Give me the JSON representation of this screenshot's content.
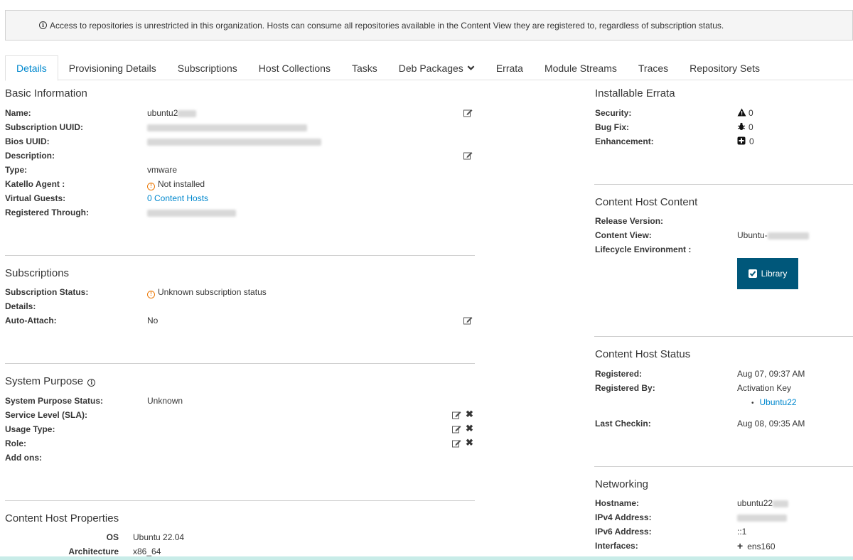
{
  "alert": {
    "text": "Access to repositories is unrestricted in this organization. Hosts can consume all repositories available in the Content View they are registered to, regardless of subscription status."
  },
  "tabs": [
    {
      "label": "Details"
    },
    {
      "label": "Provisioning Details"
    },
    {
      "label": "Subscriptions"
    },
    {
      "label": "Host Collections"
    },
    {
      "label": "Tasks"
    },
    {
      "label": "Deb Packages"
    },
    {
      "label": "Errata"
    },
    {
      "label": "Module Streams"
    },
    {
      "label": "Traces"
    },
    {
      "label": "Repository Sets"
    }
  ],
  "basic": {
    "title": "Basic Information",
    "name_label": "Name:",
    "name_value": "ubuntu2",
    "uuid_label": "Subscription UUID:",
    "bios_label": "Bios UUID:",
    "desc_label": "Description:",
    "type_label": "Type:",
    "type_value": "vmware",
    "agent_label": "Katello Agent :",
    "agent_value": "Not installed",
    "guests_label": "Virtual Guests:",
    "guests_value": "0 Content Hosts",
    "through_label": "Registered Through:"
  },
  "subs": {
    "title": "Subscriptions",
    "status_label": "Subscription Status:",
    "status_value": "Unknown subscription status",
    "details_label": "Details:",
    "auto_label": "Auto-Attach:",
    "auto_value": "No"
  },
  "purpose": {
    "title": "System Purpose",
    "status_label": "System Purpose Status:",
    "status_value": "Unknown",
    "sla_label": "Service Level (SLA):",
    "usage_label": "Usage Type:",
    "role_label": "Role:",
    "addons_label": "Add ons:"
  },
  "props": {
    "title": "Content Host Properties",
    "os_label": "OS",
    "os_value": "Ubuntu 22.04",
    "arch_label": "Architecture",
    "arch_value": "x86_64"
  },
  "errata": {
    "title": "Installable Errata",
    "security_label": "Security:",
    "security_value": "0",
    "bugfix_label": "Bug Fix:",
    "bugfix_value": "0",
    "enh_label": "Enhancement:",
    "enh_value": "0"
  },
  "content": {
    "title": "Content Host Content",
    "release_label": "Release Version:",
    "cv_label": "Content View:",
    "cv_value": "Ubuntu-",
    "lce_label": "Lifecycle Environment :",
    "lce_button": "Library"
  },
  "status": {
    "title": "Content Host Status",
    "registered_label": "Registered:",
    "registered_value": "Aug 07, 09:37 AM",
    "by_label": "Registered By:",
    "by_value": "Activation Key",
    "key_link": "Ubuntu22",
    "checkin_label": "Last Checkin:",
    "checkin_value": "Aug 08, 09:35 AM"
  },
  "net": {
    "title": "Networking",
    "host_label": "Hostname:",
    "host_value": "ubuntu22",
    "ipv4_label": "IPv4 Address:",
    "ipv6_label": "IPv6 Address:",
    "ipv6_value": "::1",
    "if_label": "Interfaces:",
    "if_value": "ens160"
  },
  "colors": {
    "accent": "#0088ce",
    "library_bg": "#00577a",
    "warning": "#ec7a08"
  }
}
